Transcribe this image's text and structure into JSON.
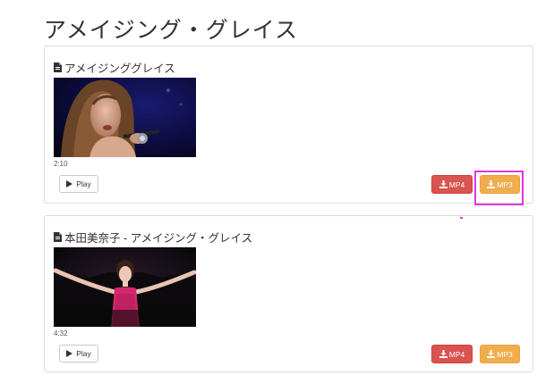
{
  "page": {
    "title": "アメイジング・グレイス"
  },
  "results": [
    {
      "title": "アメイジンググレイス",
      "duration": "2:10",
      "play_label": "Play",
      "mp4_label": "MP4",
      "mp3_label": "MP3",
      "thumbnail": "singer-performing-with-microphone"
    },
    {
      "title": "本田美奈子 - アメイジング・グレイス",
      "duration": "4:32",
      "play_label": "Play",
      "mp4_label": "MP4",
      "mp3_label": "MP3",
      "thumbnail": "singer-in-pink-dress-arms-outstretched"
    }
  ],
  "icons": {
    "file": "file-icon",
    "play": "play-icon",
    "download": "download-icon"
  },
  "colors": {
    "mp4_button": "#d9534f",
    "mp3_button": "#f0ad4e",
    "highlight": "#e036e0"
  }
}
